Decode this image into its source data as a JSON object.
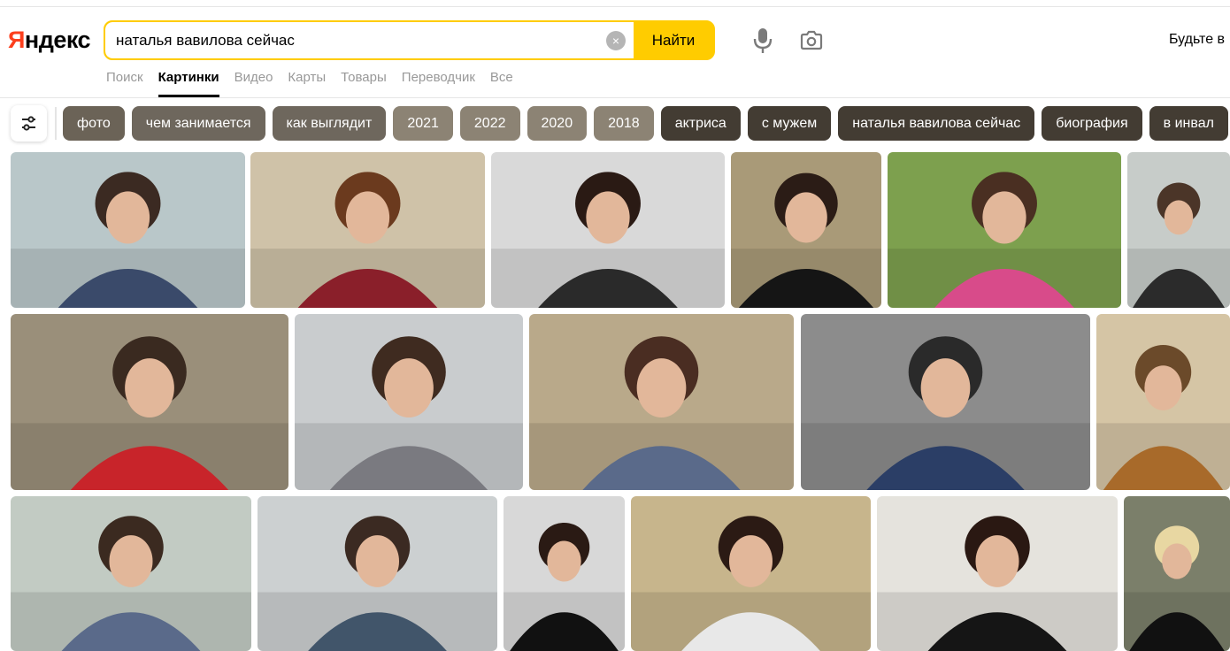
{
  "logo": {
    "first": "Я",
    "rest": "ндекс"
  },
  "search": {
    "query": "наталья вавилова сейчас",
    "find_label": "Найти",
    "clear_label": "×"
  },
  "user_link": "Будьте в",
  "tabs": [
    {
      "label": "Поиск",
      "active": false
    },
    {
      "label": "Картинки",
      "active": true
    },
    {
      "label": "Видео",
      "active": false
    },
    {
      "label": "Карты",
      "active": false
    },
    {
      "label": "Товары",
      "active": false
    },
    {
      "label": "Переводчик",
      "active": false
    },
    {
      "label": "Все",
      "active": false
    }
  ],
  "chips": [
    {
      "label": "фото",
      "color": "#6b6357"
    },
    {
      "label": "чем занимается",
      "color": "#6e675d"
    },
    {
      "label": "как выглядит",
      "color": "#6e675d"
    },
    {
      "label": "2021",
      "color": "#8c8374"
    },
    {
      "label": "2022",
      "color": "#8c8374"
    },
    {
      "label": "2020",
      "color": "#8c8374"
    },
    {
      "label": "2018",
      "color": "#8c8374"
    },
    {
      "label": "актриса",
      "color": "#433c33"
    },
    {
      "label": "с мужем",
      "color": "#433c33"
    },
    {
      "label": "наталья вавилова сейчас",
      "color": "#433c33"
    },
    {
      "label": "биография",
      "color": "#433c33"
    },
    {
      "label": "в инвал",
      "color": "#433c33"
    }
  ],
  "images": [
    {
      "bg": "#b9c7c9",
      "accent": "#3a4a6a",
      "hair": "#3b2a22"
    },
    {
      "bg": "#cfc2a8",
      "accent": "#8a1f2a",
      "hair": "#6b3a1e"
    },
    {
      "bg": "#d9d9d9",
      "accent": "#2a2a2a",
      "hair": "#2a1a14"
    },
    {
      "bg": "#a99a78",
      "accent": "#151515",
      "hair": "#2b1c16"
    },
    {
      "bg": "#7da04e",
      "accent": "#d84b8a",
      "hair": "#4a2f22"
    },
    {
      "bg": "#c7ccc9",
      "accent": "#2b2b2b",
      "hair": "#4b3528"
    },
    {
      "bg": "#9a8f7a",
      "accent": "#c8242a",
      "hair": "#3a2a20"
    },
    {
      "bg": "#c9ccce",
      "accent": "#7a7a80",
      "hair": "#3f2b20"
    },
    {
      "bg": "#b9a98a",
      "accent": "#5a6a8a",
      "hair": "#4a2d22"
    },
    {
      "bg": "#8c8c8c",
      "accent": "#2b3e66",
      "hair": "#2a2a2a"
    },
    {
      "bg": "#d5c5a5",
      "accent": "#a86a2a",
      "hair": "#6b4a2a"
    },
    {
      "bg": "#c2cbc3",
      "accent": "#5a6a8a",
      "hair": "#3b2a20"
    },
    {
      "bg": "#ccd0d1",
      "accent": "#41556a",
      "hair": "#3b2a22"
    },
    {
      "bg": "#d8d8d8",
      "accent": "#111111",
      "hair": "#2a1a14"
    },
    {
      "bg": "#c7b58c",
      "accent": "#e8e8e8",
      "hair": "#2b1a14"
    },
    {
      "bg": "#e5e3dd",
      "accent": "#151515",
      "hair": "#2a1812"
    },
    {
      "bg": "#7b7f6a",
      "accent": "#111111",
      "hair": "#e8d7a2"
    }
  ]
}
